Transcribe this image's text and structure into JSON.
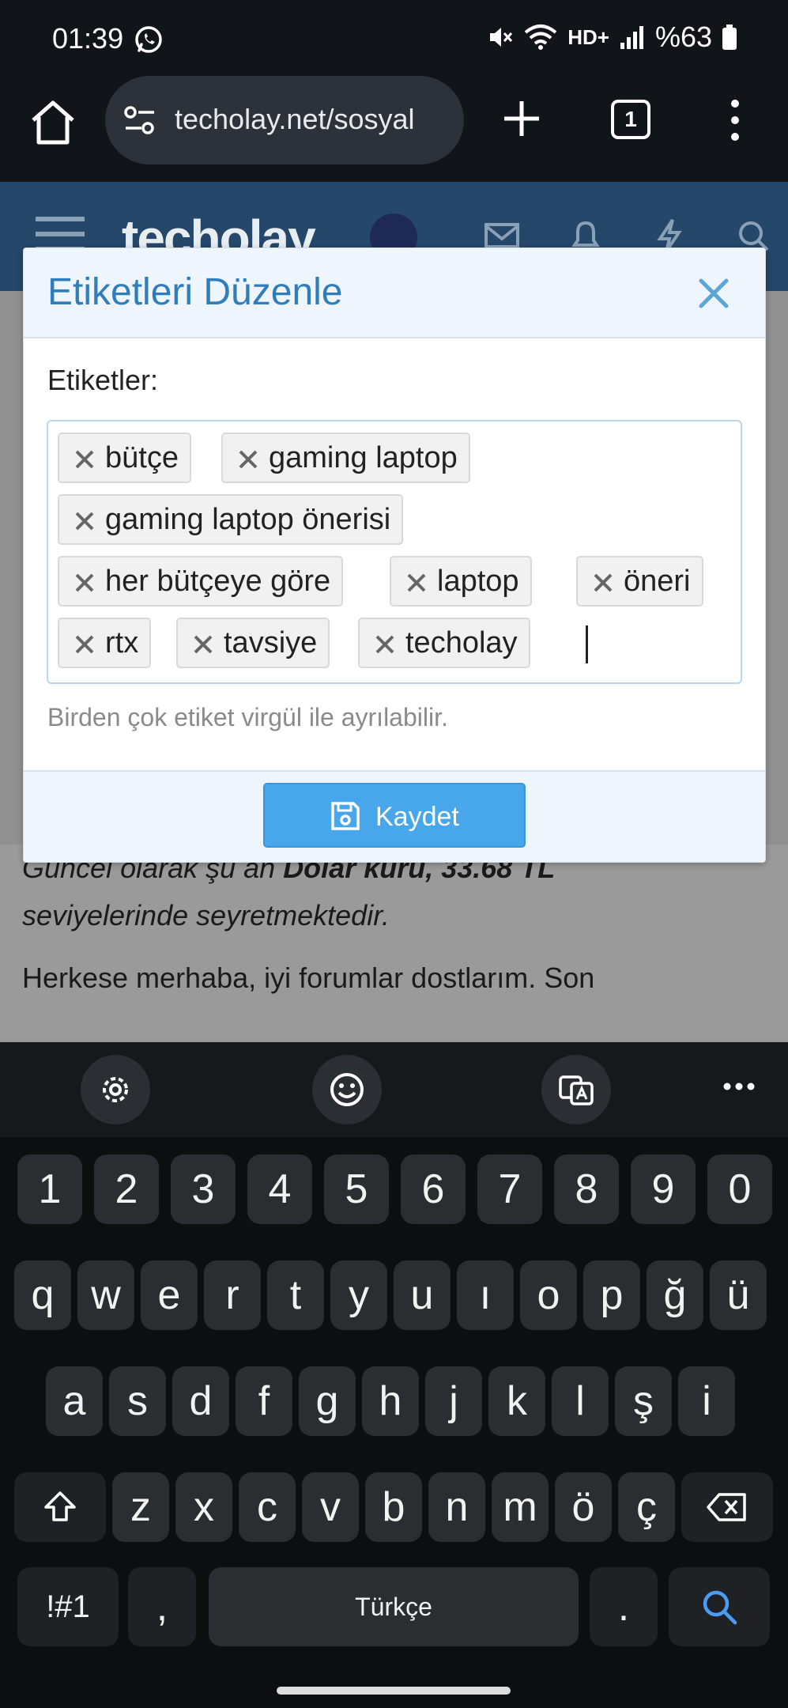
{
  "status": {
    "time": "01:39",
    "network": "HD+",
    "battery": "%63"
  },
  "browser": {
    "url": "techolay.net/sosyal",
    "tab_count": "1"
  },
  "site": {
    "logo": "techolay",
    "article_line1": "Güncel olarak şu an ",
    "article_bold": "Dolar kuru, 33.68 TL",
    "article_line2": "seviyelerinde seyretmektedir.",
    "article_para2": "Herkese merhaba, iyi forumlar dostlarım. Son"
  },
  "modal": {
    "title": "Etiketleri Düzenle",
    "field_label": "Etiketler:",
    "tags": [
      "bütçe",
      "gaming laptop",
      "gaming laptop önerisi",
      "her bütçeye göre",
      "laptop",
      "öneri",
      "rtx",
      "tavsiye",
      "techolay"
    ],
    "hint": "Birden çok etiket virgül ile ayrılabilir.",
    "save_label": "Kaydet"
  },
  "keyboard": {
    "number_row": [
      "1",
      "2",
      "3",
      "4",
      "5",
      "6",
      "7",
      "8",
      "9",
      "0"
    ],
    "row1": [
      "q",
      "w",
      "e",
      "r",
      "t",
      "y",
      "u",
      "ı",
      "o",
      "p",
      "ğ",
      "ü"
    ],
    "row2": [
      "a",
      "s",
      "d",
      "f",
      "g",
      "h",
      "j",
      "k",
      "l",
      "ş",
      "i"
    ],
    "row3": [
      "z",
      "x",
      "c",
      "v",
      "b",
      "n",
      "m",
      "ö",
      "ç"
    ],
    "symbols_label": "!#1",
    "comma": ",",
    "space_label": "Türkçe",
    "period": "."
  },
  "colors": {
    "accent": "#2f7dbb",
    "save_button": "#48a7ea",
    "header": "#24476a"
  }
}
